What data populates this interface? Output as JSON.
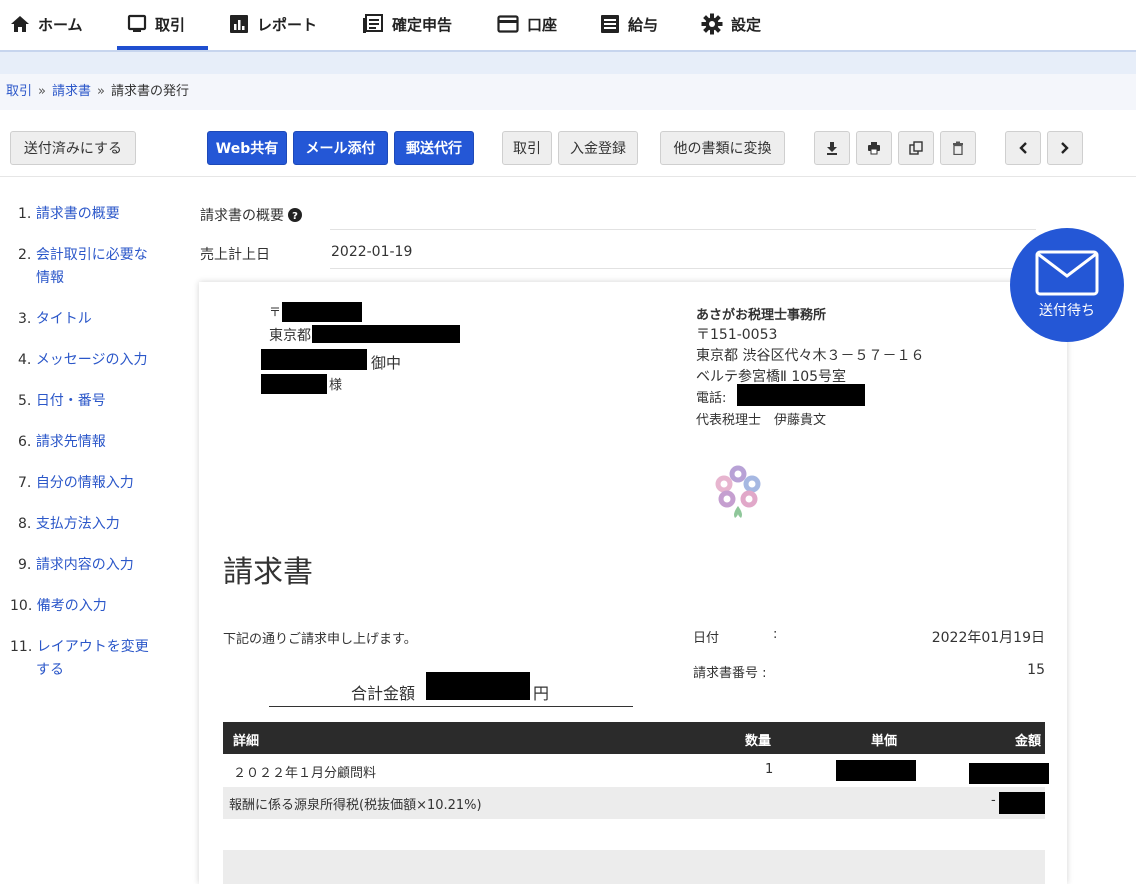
{
  "nav": {
    "items": [
      {
        "label": "ホーム",
        "icon": "home-icon"
      },
      {
        "label": "取引",
        "icon": "transaction-icon"
      },
      {
        "label": "レポート",
        "icon": "report-icon"
      },
      {
        "label": "確定申告",
        "icon": "tax-return-icon"
      },
      {
        "label": "口座",
        "icon": "account-card-icon"
      },
      {
        "label": "給与",
        "icon": "payroll-icon"
      },
      {
        "label": "設定",
        "icon": "gear-icon"
      }
    ],
    "active_index": 1,
    "accent_color": "#1f4fd0"
  },
  "breadcrumb": {
    "items": [
      "取引",
      "請求書",
      "請求書の発行"
    ],
    "separator": "»"
  },
  "toolbar": {
    "mark_sent": "送付済みにする",
    "web_share": "Web共有",
    "mail_attach": "メール添付",
    "postal_proxy": "郵送代行",
    "transaction": "取引",
    "payment_register": "入金登録",
    "convert_other": "他の書類に変換",
    "download_icon": "download-icon",
    "print_icon": "print-icon",
    "copy_icon": "copy-icon",
    "delete_icon": "trash-icon",
    "prev_icon": "chevron-left-icon",
    "next_icon": "chevron-right-icon"
  },
  "sidebar": {
    "items": [
      {
        "num": "1.",
        "label": "請求書の概要"
      },
      {
        "num": "2.",
        "label": "会計取引に必要な",
        "label2": "情報"
      },
      {
        "num": "3.",
        "label": "タイトル"
      },
      {
        "num": "4.",
        "label": "メッセージの入力"
      },
      {
        "num": "5.",
        "label": "日付・番号"
      },
      {
        "num": "6.",
        "label": "請求先情報"
      },
      {
        "num": "7.",
        "label": "自分の情報入力"
      },
      {
        "num": "8.",
        "label": "支払方法入力"
      },
      {
        "num": "9.",
        "label": "請求内容の入力"
      },
      {
        "num": "10.",
        "label": "備考の入力"
      },
      {
        "num": "11.",
        "label": "レイアウトを変更",
        "label2": "する"
      }
    ]
  },
  "overview": {
    "heading": "請求書の概要",
    "help_icon": "question-circle-icon",
    "sales_date_label": "売上計上日",
    "sales_date_value": "2022-01-19"
  },
  "status_badge": {
    "label": "送付待ち",
    "icon": "envelope-icon",
    "color": "#2457d6"
  },
  "invoice": {
    "recipient": {
      "postal_prefix": "〒",
      "pref": "東京都",
      "honorific_company": "御中",
      "honorific_person": "様"
    },
    "issuer": {
      "name": "あさがお税理士事務所",
      "postal": "〒151-0053",
      "address1": "東京都 渋谷区代々木３－５７－１６",
      "address2": "ベルテ参宮橋Ⅱ 105号室",
      "phone_label": "電話:",
      "representative": "代表税理士　伊藤貴文"
    },
    "title": "請求書",
    "message": "下記の通りご請求申し上げます。",
    "date_label": "日付",
    "date_colon": ":",
    "date_value": "2022年01月19日",
    "number_label": "請求書番号 :",
    "number_value": "15",
    "total_label": "合計金額",
    "total_unit": "円",
    "table": {
      "headers": [
        "詳細",
        "数量",
        "単価",
        "金額"
      ],
      "rows": [
        {
          "detail": "２０２２年１月分顧問料",
          "qty": "1"
        },
        {
          "detail": "報酬に係る源泉所得税(税抜価額×10.21%)",
          "amount_prefix": "-"
        }
      ]
    }
  }
}
